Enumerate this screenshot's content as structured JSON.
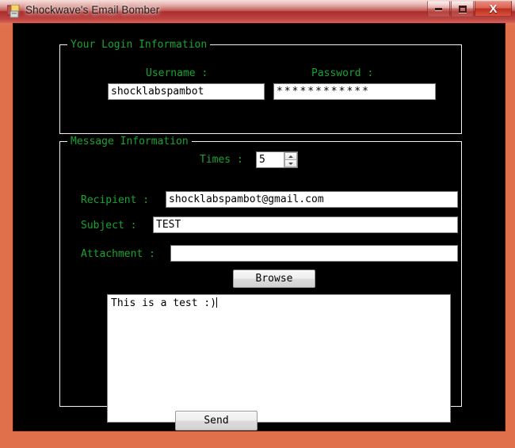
{
  "window": {
    "title": "Shockwave's Email Bomber",
    "icon": "app-icon",
    "controls": {
      "minimize_label": "Minimize",
      "maximize_label": "Maximize",
      "close_label": "X"
    },
    "frame_color": "#e0704c",
    "titlebar_color": "#b83c3a",
    "client_background": "#000000"
  },
  "theme": {
    "label_green": "#19a332",
    "group_border": "#f2f2f2",
    "input_background": "#ffffff",
    "input_text": "#000000"
  },
  "login_group": {
    "legend": "Your Login Information",
    "username": {
      "label": "Username :",
      "value": "shocklabspambot",
      "placeholder": ""
    },
    "password": {
      "label": "Password :",
      "value": "************",
      "placeholder": ""
    }
  },
  "message_group": {
    "legend": "Message Information",
    "times": {
      "label": "Times :",
      "value": "5",
      "spin_up_icon": "chevron-up-icon",
      "spin_down_icon": "chevron-down-icon"
    },
    "recipient": {
      "label": "Recipient :",
      "value": "shocklabspambot@gmail.com",
      "placeholder": ""
    },
    "subject": {
      "label": "Subject :",
      "value": "TEST",
      "placeholder": ""
    },
    "attachment": {
      "label": "Attachment :",
      "value": "",
      "placeholder": ""
    },
    "browse_button": "Browse",
    "body": {
      "value": "This is a test :)"
    }
  },
  "actions": {
    "send_button": "Send"
  }
}
